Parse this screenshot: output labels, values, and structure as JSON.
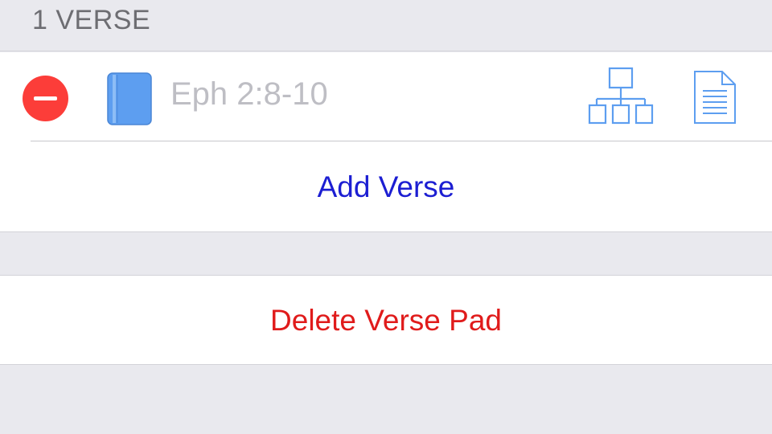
{
  "section": {
    "header": "1 VERSE"
  },
  "verses": [
    {
      "reference": "Eph 2:8-10",
      "delete_icon": "minus-circle-icon",
      "book_icon": "book-icon",
      "diagram_icon": "hierarchy-diagram-icon",
      "document_icon": "document-icon"
    }
  ],
  "actions": {
    "add_verse_label": "Add Verse",
    "delete_pad_label": "Delete Verse Pad"
  },
  "colors": {
    "background": "#e9e9ee",
    "delete_red": "#fc3d39",
    "accent_blue": "#1c1ed2",
    "icon_blue": "#5d9ef0",
    "destructive_red": "#e01b1b",
    "placeholder_gray": "#bebec4"
  }
}
